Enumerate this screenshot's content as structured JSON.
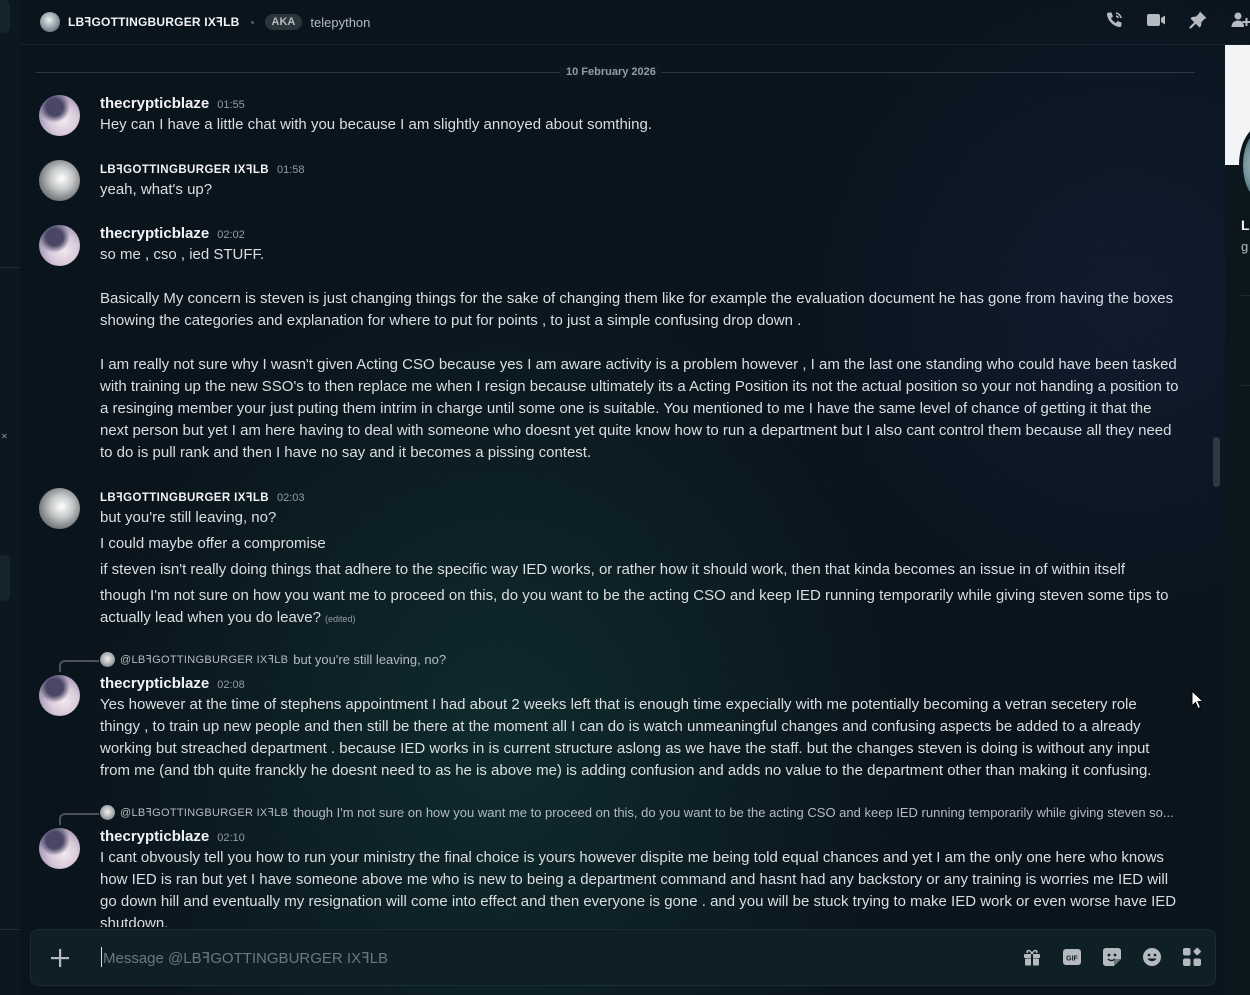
{
  "header": {
    "dm_name": "LBꟻGOTTINGBURGER IXꟻLB",
    "aka_label": "AKA",
    "aka_name": "telepython"
  },
  "date_divider": "10 February 2026",
  "messages": [
    {
      "author": "thecrypticblaze",
      "time": "01:55",
      "lines": [
        "Hey can I have a little chat with you because I am slightly annoyed about somthing."
      ]
    },
    {
      "author": "LBꟻGOTTINGBURGER IXꟻLB",
      "time": "01:58",
      "lines": [
        "yeah, what's up?"
      ]
    },
    {
      "author": "thecrypticblaze",
      "time": "02:02",
      "lines": [
        "so me , cso , ied STUFF.",
        "Basically My concern is steven is just changing things for the sake of changing them like for example the evaluation document he has gone from having the boxes showing the categories and explanation for where to put for points , to just a simple confusing drop down .",
        "I am really not sure why I wasn't given Acting CSO because yes I am aware activity is a problem however , I am the last one standing who could have been tasked with training up the new SSO's to then replace me when I resign because ultimately its a Acting Position its not the actual position so your not handing a position to a resinging member your just puting them intrim in charge until some one is suitable. You mentioned to me I have the same level of chance of getting it that the next person but yet I am here having to deal with someone who doesnt yet quite know how to run a department but I also cant control them because all they need to do is pull rank and then I have no say and it becomes a pissing contest."
      ]
    },
    {
      "author": "LBꟻGOTTINGBURGER IXꟻLB",
      "time": "02:03",
      "lines": [
        "but you're still leaving, no?",
        "I could maybe offer a compromise",
        "if steven isn't really doing things that adhere to the specific way IED works, or rather how it should work, then that kinda becomes an issue in of within itself",
        "though I'm not sure on how you want me to proceed on this, do you want to be the acting CSO and keep IED running temporarily while giving steven some tips to actually lead when you do leave?"
      ],
      "edited": "(edited)"
    },
    {
      "reply_to": "@LBꟻGOTTINGBURGER IXꟻLB",
      "reply_text": "but you're still leaving, no?",
      "author": "thecrypticblaze",
      "time": "02:08",
      "lines": [
        "Yes however at the time of stephens appointment I had about 2 weeks left that is enough time expecially with me potentially becoming a vetran secetery role thingy , to train up new people and then still be there at the moment all I can do is watch unmeaningful changes and confusing aspects be added to a already working but streached department . because IED works in is current structure aslong as we have the staff. but the changes steven is doing is without any input from me (and tbh quite franckly he doesnt need to as he is above me) is adding confusion and adds no value to the department other than making it confusing."
      ]
    },
    {
      "reply_to": "@LBꟻGOTTINGBURGER IXꟻLB",
      "reply_text": "though I'm not sure on how you want me to proceed on this, do you want to be the acting CSO and keep IED running temporarily while giving steven so...",
      "author": "thecrypticblaze",
      "time": "02:10",
      "lines": [
        "I cant obvously tell you how to run your ministry the final choice is yours however dispite me being told equal chances and yet I am the only one here who knows how IED is ran but yet I have someone above me who is new to being a department command and hasnt had any backstory or any training is worries me IED will go down hill and eventually my resignation will come into effect and then everyone is gone . and you will be stuck trying to make IED work or even worse have IED shutdown."
      ]
    }
  ],
  "composer": {
    "placeholder": "Message @LBꟻGOTTINGBURGER IXꟻLB"
  },
  "icons": {
    "header": [
      "phone-icon",
      "video-icon",
      "pin-icon",
      "add-friend-icon"
    ],
    "composer": [
      "plus-icon",
      "gift-icon",
      "gif-icon",
      "sticker-icon",
      "emoji-icon",
      "apps-icon"
    ]
  },
  "colors": {
    "background": "#0a141d",
    "text": "#dbdee1",
    "muted": "#949ba4",
    "accent_teal": "#0f2b2e"
  }
}
